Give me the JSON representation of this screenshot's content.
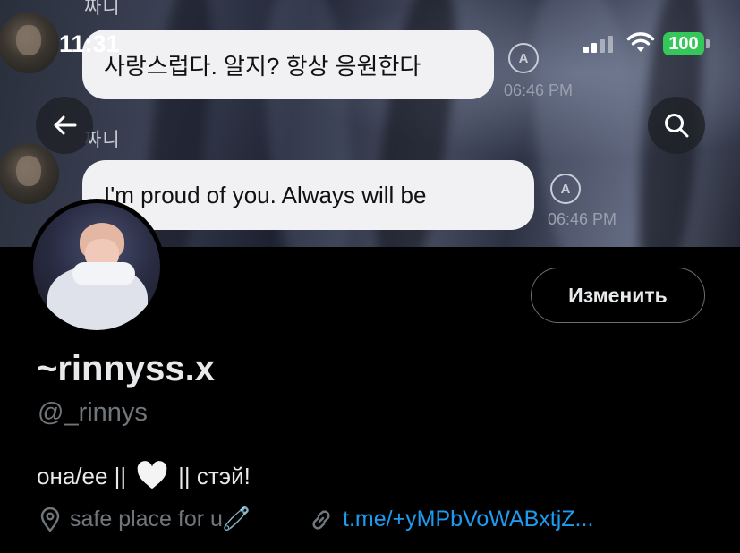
{
  "status_bar": {
    "time": "11:31",
    "battery": "100"
  },
  "banner_chat": {
    "messages": [
      {
        "sender": "짜니",
        "text": "사랑스럽다. 알지? 항상 응원한다",
        "time": "06:46 PM"
      },
      {
        "sender": "짜니",
        "text": "I'm proud of you. Always will be",
        "time": "06:46 PM"
      }
    ],
    "translate_icon": "A"
  },
  "profile": {
    "display_name": "~rinnyss.x",
    "handle": "@_rinnys",
    "edit_button": "Изменить",
    "bio": {
      "before": "она/ее ||",
      "after": "|| стэй!"
    },
    "location": "safe place for u🧷",
    "link": "t.me/+yMPbVoWABxtjZ..."
  },
  "icons": {
    "back": "arrow-left-icon",
    "search": "search-icon",
    "location": "location-pin-icon",
    "link": "link-icon",
    "heart": "white-heart-icon"
  },
  "colors": {
    "link": "#1d9bf0",
    "battery": "#35c759",
    "secondary_text": "#71767b"
  }
}
